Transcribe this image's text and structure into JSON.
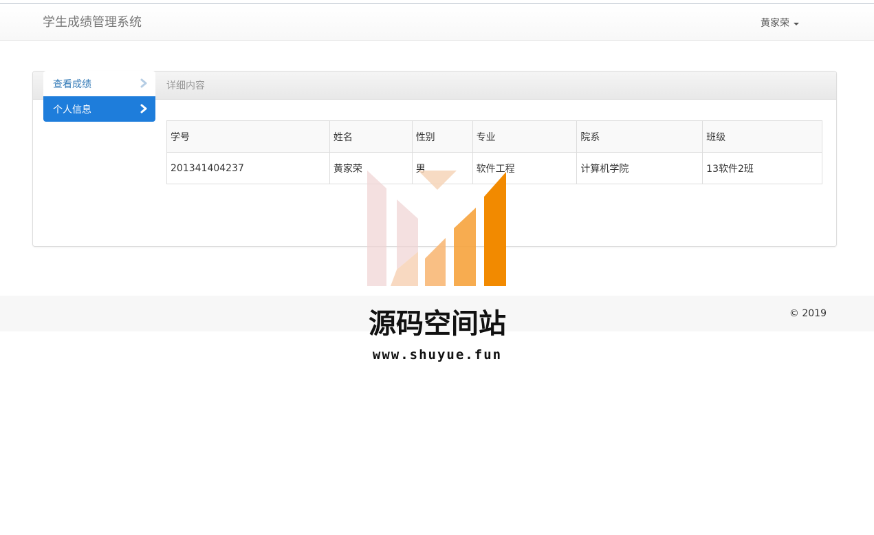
{
  "navbar": {
    "brand": "学生成绩管理系统",
    "user_name": "黄家荣"
  },
  "sidebar": {
    "items": [
      {
        "label": "查看成绩",
        "active": false
      },
      {
        "label": "个人信息",
        "active": true
      }
    ]
  },
  "panel": {
    "title": "详细内容"
  },
  "student_table": {
    "headers": [
      "学号",
      "姓名",
      "性别",
      "专业",
      "院系",
      "班级"
    ],
    "rows": [
      [
        "201341404237",
        "黄家荣",
        "男",
        "软件工程",
        "计算机学院",
        "13软件2班"
      ]
    ]
  },
  "footer": {
    "copyright": "© 2019"
  },
  "watermark": {
    "title": "源码空间站",
    "url": "www.shuyue.fun"
  },
  "colors": {
    "active_nav": "#1e7ddb",
    "link": "#337ab7",
    "watermark_orange": "#f28a00"
  },
  "icons": {
    "nav_chevron": "chevron-right-icon",
    "user_caret": "caret-down-icon"
  }
}
